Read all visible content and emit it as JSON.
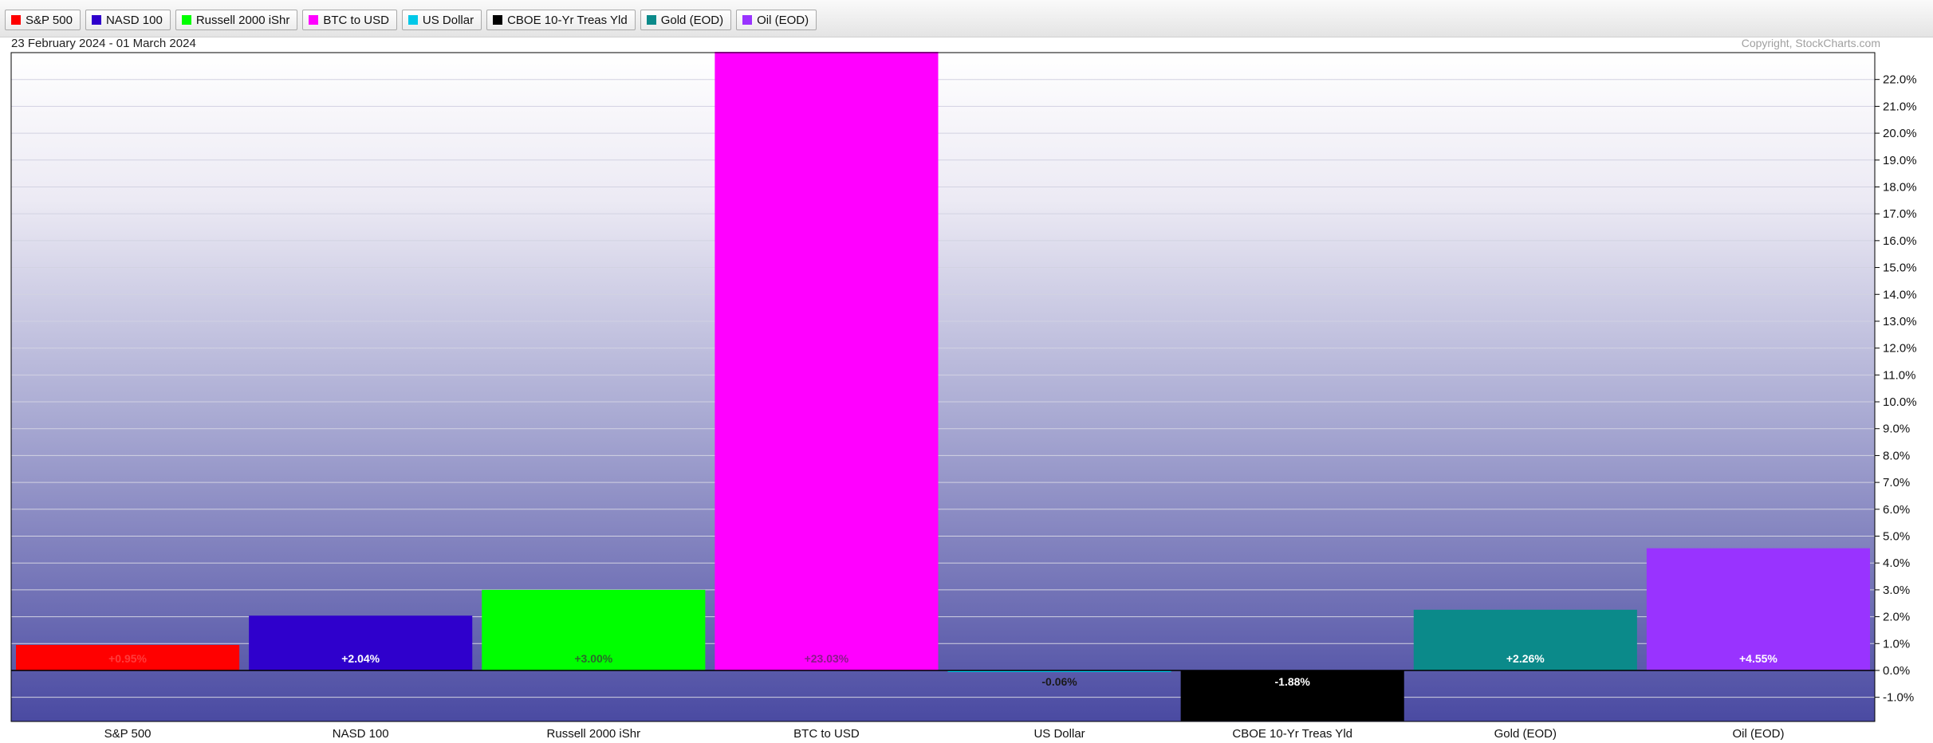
{
  "legend": [
    {
      "label": "S&P 500",
      "color": "#ff0000"
    },
    {
      "label": "NASD 100",
      "color": "#2f00cc"
    },
    {
      "label": "Russell 2000 iShr",
      "color": "#00ff00"
    },
    {
      "label": "BTC to USD",
      "color": "#ff00ff"
    },
    {
      "label": "US Dollar",
      "color": "#00c8e8"
    },
    {
      "label": "CBOE 10-Yr Treas Yld",
      "color": "#000000"
    },
    {
      "label": "Gold (EOD)",
      "color": "#0b8a8a"
    },
    {
      "label": "Oil (EOD)",
      "color": "#9933ff"
    }
  ],
  "header": {
    "date_range": "23 February 2024 - 01 March 2024",
    "copyright": "Copyright, StockCharts.com"
  },
  "chart_data": {
    "type": "bar",
    "categories": [
      "S&P 500",
      "NASD 100",
      "Russell 2000 iShr",
      "BTC to USD",
      "US Dollar",
      "CBOE 10-Yr Treas Yld",
      "Gold (EOD)",
      "Oil (EOD)"
    ],
    "values": [
      0.95,
      2.04,
      3.0,
      23.03,
      -0.06,
      -1.88,
      2.26,
      4.55
    ],
    "value_labels": [
      "+0.95%",
      "+2.04%",
      "+3.00%",
      "+23.03%",
      "-0.06%",
      "-1.88%",
      "+2.26%",
      "+4.55%"
    ],
    "colors": [
      "#ff0000",
      "#2f00cc",
      "#00ff00",
      "#ff00ff",
      "#00c8e8",
      "#000000",
      "#0b8a8a",
      "#9933ff"
    ],
    "label_colors": [
      "#ff3b3b",
      "#ffffff",
      "#2a6a2a",
      "#8a1a8a",
      "#1a1a1a",
      "#ffffff",
      "#ffffff",
      "#ffffff"
    ],
    "ylim": [
      -1.9,
      23.0
    ],
    "yticks": [
      -1,
      0,
      1,
      2,
      3,
      4,
      5,
      6,
      7,
      8,
      9,
      10,
      11,
      12,
      13,
      14,
      15,
      16,
      17,
      18,
      19,
      20,
      21,
      22
    ],
    "ytick_labels": [
      "-1.0%",
      "0.0%",
      "1.0%",
      "2.0%",
      "3.0%",
      "4.0%",
      "5.0%",
      "6.0%",
      "7.0%",
      "8.0%",
      "9.0%",
      "10.0%",
      "11.0%",
      "12.0%",
      "13.0%",
      "14.0%",
      "15.0%",
      "16.0%",
      "17.0%",
      "18.0%",
      "19.0%",
      "20.0%",
      "21.0%",
      "22.0%"
    ],
    "grid": true,
    "title": "",
    "xlabel": "",
    "ylabel": ""
  }
}
